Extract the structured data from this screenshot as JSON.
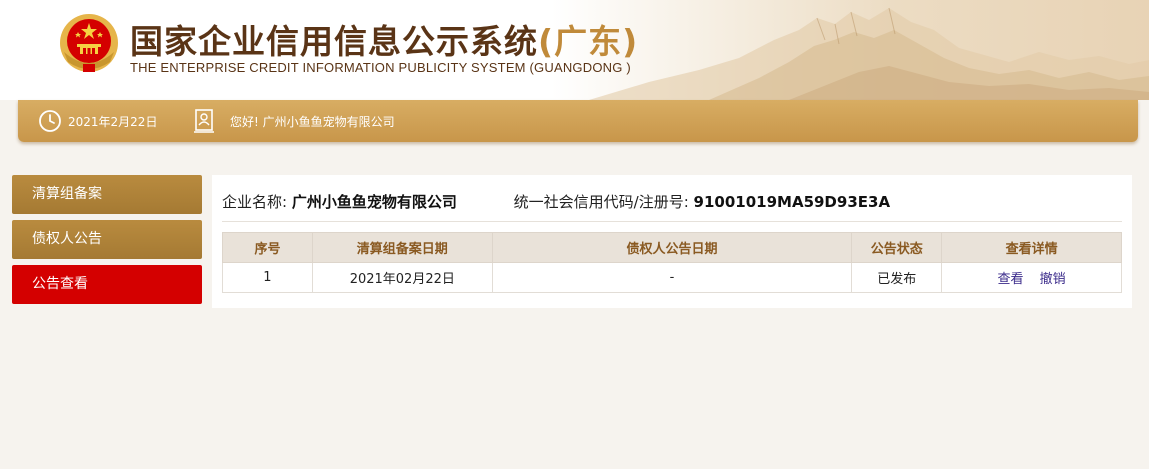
{
  "header": {
    "title_cn": "国家企业信用信息公示系统",
    "title_region": "(广东)",
    "title_en": "THE ENTERPRISE CREDIT INFORMATION PUBLICITY SYSTEM (GUANGDONG )",
    "emblem_icon": "national-emblem-icon",
    "emblem_color": "#d40000",
    "title_color": "#5a3416",
    "accent_color": "#c08a3a"
  },
  "infobar": {
    "date": "2021年2月22日",
    "greeting": "您好!  广州小鱼鱼宠物有限公司",
    "clock_icon": "clock-icon",
    "user_icon": "user-card-icon",
    "bar_color": "#d0a256"
  },
  "sidebar": {
    "items": [
      {
        "label": "清算组备案",
        "active": false
      },
      {
        "label": "债权人公告",
        "active": false
      },
      {
        "label": "公告查看",
        "active": true
      }
    ],
    "item_color": "#b0843a",
    "active_color": "#d40000"
  },
  "main": {
    "company_label": "企业名称:",
    "company_name": "广州小鱼鱼宠物有限公司",
    "code_label": "统一社会信用代码/注册号:",
    "code_value": "91001019MA59D93E3A",
    "table": {
      "headers": [
        "序号",
        "清算组备案日期",
        "债权人公告日期",
        "公告状态",
        "查看详情"
      ],
      "rows": [
        {
          "index": "1",
          "filing_date": "2021年02月22日",
          "notice_date": "-",
          "status": "已发布",
          "actions": [
            "查看",
            "撤销"
          ]
        }
      ]
    }
  }
}
